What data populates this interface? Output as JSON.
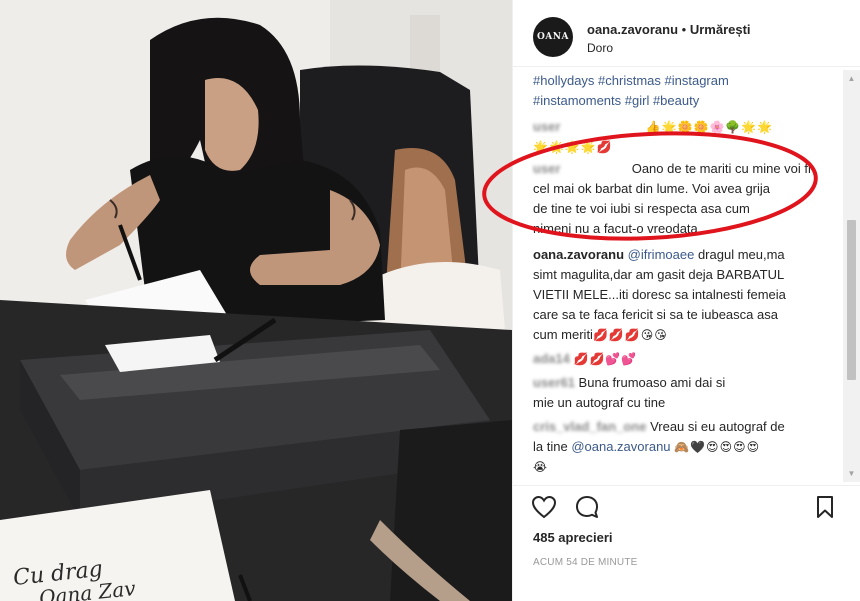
{
  "post": {
    "username": "oana.zavoranu",
    "separator": "•",
    "follow_state": "Urmărești",
    "location": "Doro",
    "avatar_text": "OANA"
  },
  "comments": {
    "hashtags_1": "#hollydays #christmas #instagram",
    "hashtags_2": "#instamoments #girl #beauty",
    "c1_user": "user",
    "c1_emoji_1": "👍🌟🌼🌼🌸🌳🌟🌟",
    "c1_emoji_2": "🌟🌟🌟🌟💋",
    "c2_user": "user",
    "c2_line1": "Oano de te mariti cu mine voi fi",
    "c2_line2": "cel mai ok barbat din lume. Voi avea grija",
    "c2_line3": "de tine te voi iubi si respecta asa cum",
    "c2_line4": "nimeni nu a facut-o vreodata...",
    "r_user": "oana.zavoranu",
    "r_mention": "@ifrimoaee",
    "r_line1": "dragul meu,ma",
    "r_line2": "simt magulita,dar am gasit deja BARBATUL",
    "r_line3": "VIETII MELE...iti doresc sa intalnesti femeia",
    "r_line4": "care sa te faca fericit si sa te iubeasca asa",
    "r_line5_text": "cum meriti",
    "r_line5_emoji": "💋💋💋😘😘",
    "c3_user": "ada14",
    "c3_emoji": "💋💋💕💕",
    "c4_user": "user61",
    "c4_line1": "Buna frumoaso ami dai si",
    "c4_line2": "mie un autograf cu tine",
    "c5_user": "cris_vlad_fan_one",
    "c5_line1": "Vreau si eu autograf de",
    "c5_line2_text": "la tine",
    "c5_mention": "@oana.zavoranu",
    "c5_emoji": "🙈🖤😍😍😍😍",
    "c5_emoji_2": "😭"
  },
  "actions": {
    "likes": "485 aprecieri",
    "time_ago": "ACUM 54 DE MINUTE"
  },
  "photo": {
    "note_line1": "Cu drag",
    "note_line2": "Oana Zav"
  },
  "colors": {
    "highlight_ellipse": "#e0141c",
    "link": "#3c5a8a"
  }
}
